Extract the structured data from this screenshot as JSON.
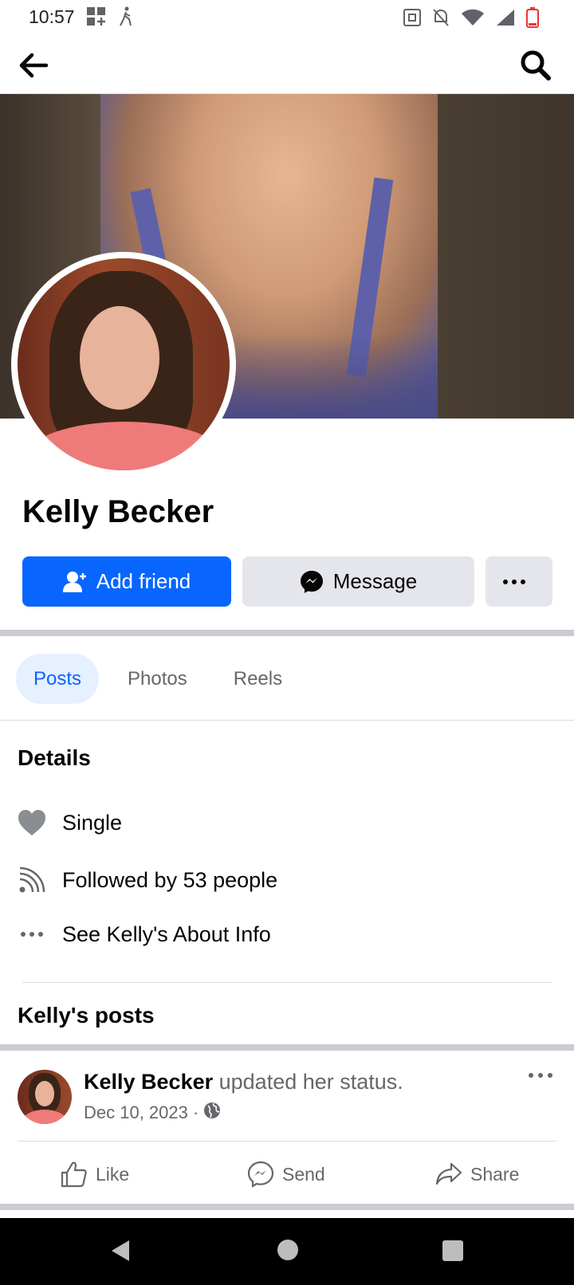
{
  "status_bar": {
    "time": "10:57"
  },
  "profile": {
    "name": "Kelly Becker"
  },
  "actions": {
    "add_friend": "Add friend",
    "message": "Message"
  },
  "tabs": [
    {
      "label": "Posts"
    },
    {
      "label": "Photos"
    },
    {
      "label": "Reels"
    }
  ],
  "details": {
    "title": "Details",
    "items": [
      {
        "icon": "heart-icon",
        "text": "Single"
      },
      {
        "icon": "rss-feed-icon",
        "text": "Followed by 53 people"
      },
      {
        "icon": "more-dots-icon",
        "text": "See Kelly's About Info"
      }
    ]
  },
  "posts": {
    "title": "Kelly's posts",
    "items": [
      {
        "author": "Kelly Becker",
        "action": "updated her status.",
        "date": "Dec 10, 2023"
      }
    ]
  },
  "post_actions": {
    "like": "Like",
    "send": "Send",
    "share": "Share"
  },
  "colors": {
    "primary": "#0866ff",
    "secondary_bg": "#e4e6eb",
    "tab_active_bg": "#e7f0ff",
    "muted_text": "#65676b"
  }
}
